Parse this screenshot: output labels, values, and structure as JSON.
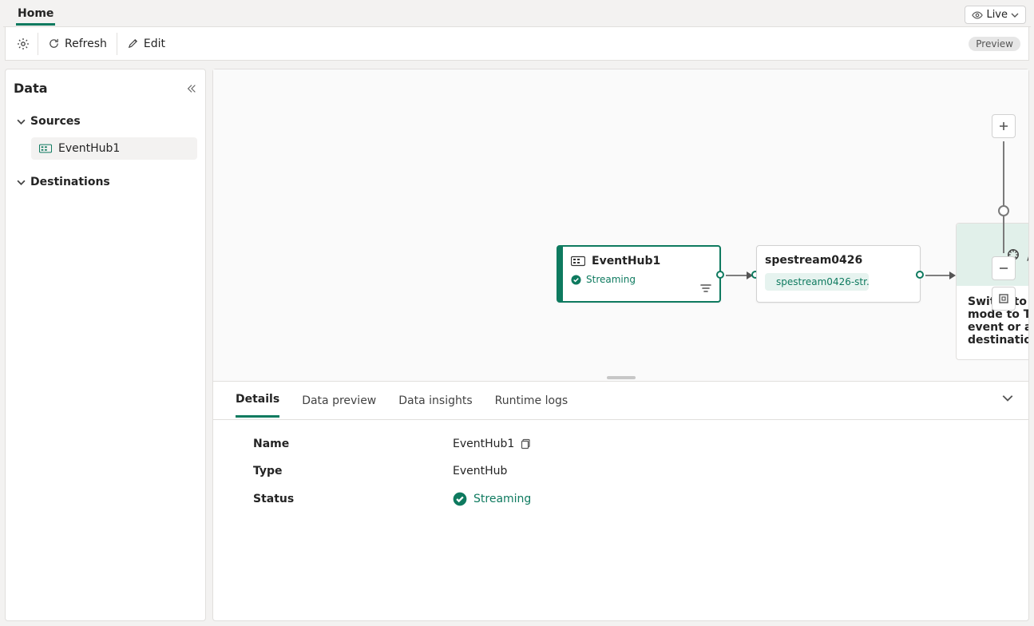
{
  "topbar": {
    "tab_home": "Home",
    "live_label": "Live"
  },
  "toolbar": {
    "refresh": "Refresh",
    "edit": "Edit",
    "preview_badge": "Preview"
  },
  "sidepanel": {
    "title": "Data",
    "sources_label": "Sources",
    "destinations_label": "Destinations",
    "source_item": "EventHub1"
  },
  "canvas": {
    "source": {
      "name": "EventHub1",
      "status": "Streaming"
    },
    "stream": {
      "name": "spestream0426",
      "chip": "spestream0426-str..."
    },
    "placeholder": {
      "text": "Switch to edit mode to Transform event or add destination",
      "slash": "/"
    }
  },
  "details": {
    "tabs": {
      "details": "Details",
      "data_preview": "Data preview",
      "data_insights": "Data insights",
      "runtime_logs": "Runtime logs"
    },
    "rows": {
      "name_k": "Name",
      "name_v": "EventHub1",
      "type_k": "Type",
      "type_v": "EventHub",
      "status_k": "Status",
      "status_v": "Streaming"
    }
  }
}
